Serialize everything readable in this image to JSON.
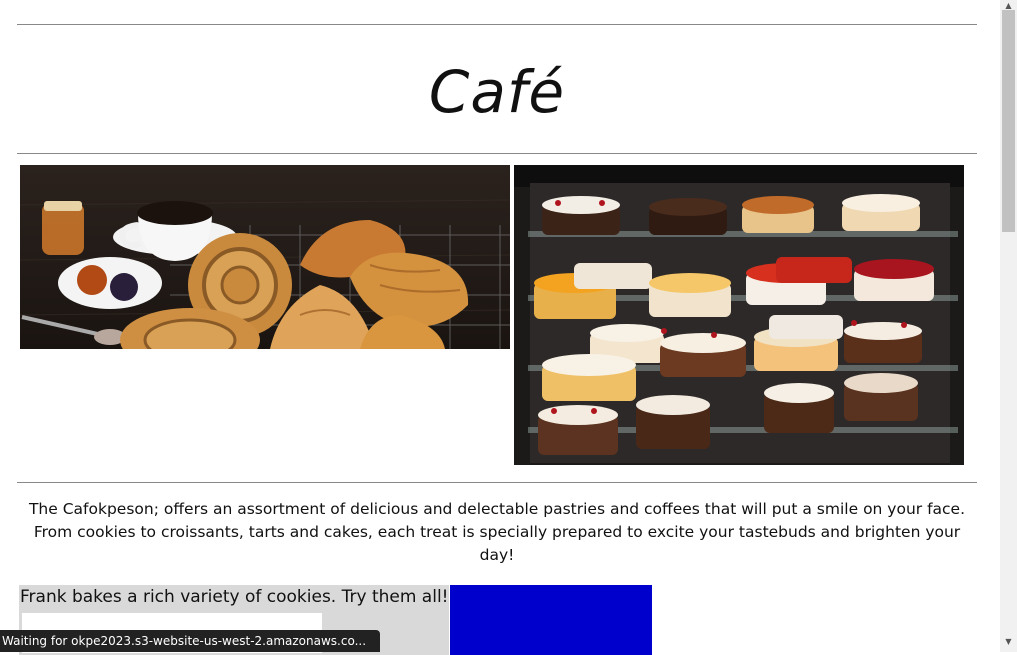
{
  "header": {
    "title": "Café"
  },
  "intro": {
    "text": "The Cafokpeson; offers an assortment of delicious and delectable pastries and coffees that will put a smile on your face. From cookies to croissants, tarts and cakes, each treat is specially prepared to excite your tastebuds and brighten your day!"
  },
  "frank": {
    "text": "Frank bakes a rich variety of cookies. Try them all!"
  },
  "status_bar": {
    "text": "Waiting for okpe2023.s3-website-us-west-2.amazonaws.co..."
  },
  "colors": {
    "blue_box": "#0000cc",
    "grey_box": "#d9d9d9"
  },
  "icons": {
    "scroll_up": "scroll-up-arrow-icon",
    "scroll_down": "scroll-down-arrow-icon"
  }
}
